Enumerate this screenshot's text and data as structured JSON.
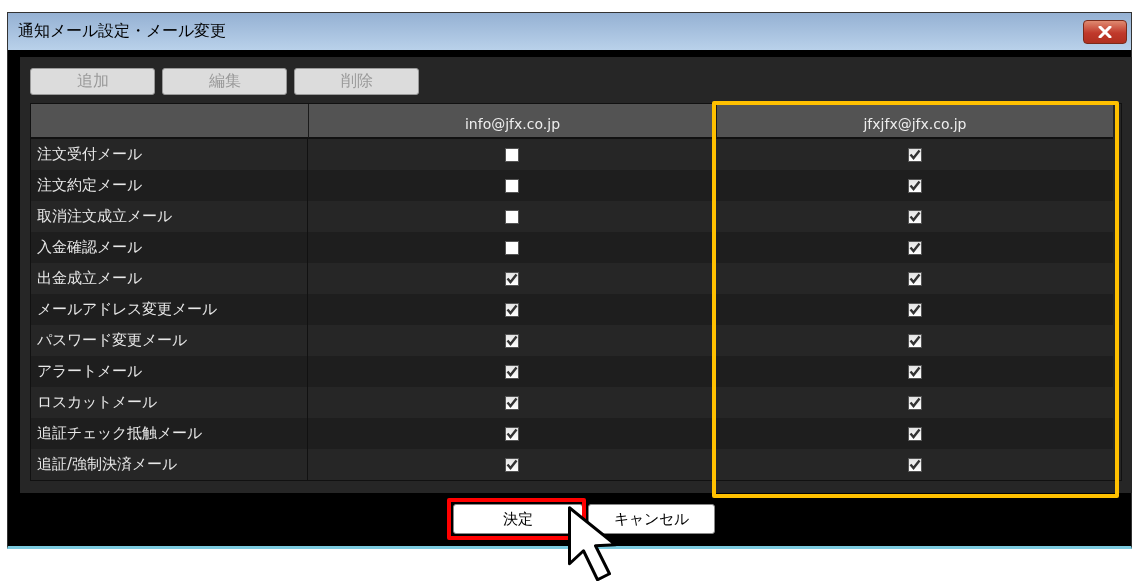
{
  "window": {
    "title": "通知メール設定・メール変更"
  },
  "toolbar": [
    {
      "label": "追加",
      "disabled": true
    },
    {
      "label": "編集",
      "disabled": true
    },
    {
      "label": "削除",
      "disabled": true
    }
  ],
  "table": {
    "columns": [
      {
        "label": "info@jfx.co.jp"
      },
      {
        "label": "jfxjfx@jfx.co.jp",
        "color": "#ffc000"
      }
    ],
    "rows": [
      {
        "label": "注文受付メール",
        "checked": [
          false,
          true
        ]
      },
      {
        "label": "注文約定メール",
        "checked": [
          false,
          true
        ]
      },
      {
        "label": "取消注文成立メール",
        "checked": [
          false,
          true
        ]
      },
      {
        "label": "入金確認メール",
        "checked": [
          false,
          true
        ]
      },
      {
        "label": "出金成立メール",
        "checked": [
          true,
          true
        ]
      },
      {
        "label": "メールアドレス変更メール",
        "checked": [
          true,
          true
        ]
      },
      {
        "label": "パスワード変更メール",
        "checked": [
          true,
          true
        ]
      },
      {
        "label": "アラートメール",
        "checked": [
          true,
          true
        ]
      },
      {
        "label": "ロスカットメール",
        "checked": [
          true,
          true
        ]
      },
      {
        "label": "追証チェック抵触メール",
        "checked": [
          true,
          true
        ]
      },
      {
        "label": "追証/強制決済メール",
        "checked": [
          true,
          true
        ]
      }
    ]
  },
  "footer": [
    {
      "label": "決定",
      "color": "#ff0000"
    },
    {
      "label": "キャンセル"
    }
  ]
}
